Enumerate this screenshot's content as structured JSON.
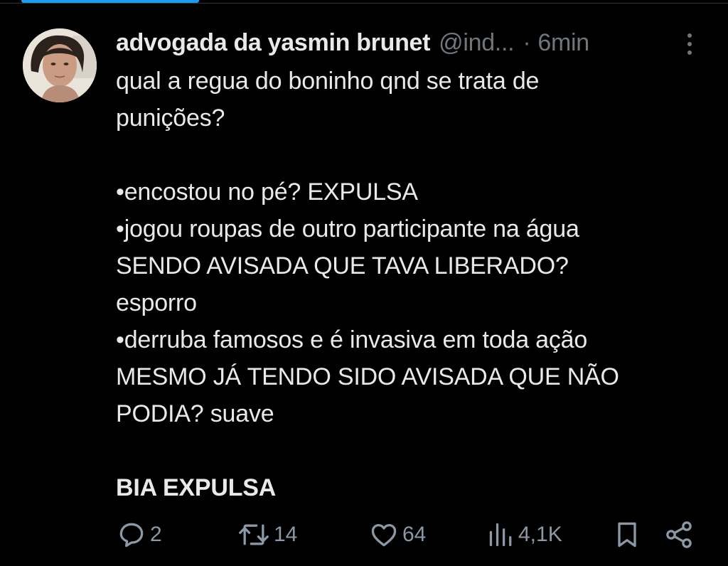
{
  "tweet": {
    "author_name": "advogada da yasmin brunet",
    "handle": "@ind...",
    "separator": "·",
    "time": "6min",
    "lines": [
      "qual a regua do boninho qnd se trata de",
      "punições?",
      "",
      "•encostou no pé? EXPULSA",
      "•jogou roupas de outro participante na água",
      "SENDO AVISADA QUE TAVA LIBERADO?",
      "esporro",
      "•derruba famosos e é invasiva em toda ação",
      "MESMO JÁ TENDO SIDO AVISADA QUE NÃO",
      "PODIA? suave",
      ""
    ],
    "final_line": "BIA EXPULSA"
  },
  "actions": {
    "replies": "2",
    "reposts": "14",
    "likes": "64",
    "views": "4,1K",
    "icons": [
      "reply-icon",
      "repost-icon",
      "like-icon",
      "views-icon",
      "bookmark-icon",
      "share-icon"
    ]
  },
  "colors": {
    "background": "#000000",
    "text": "#e7e9ea",
    "muted": "#71767b",
    "accent": "#1d9bf0"
  }
}
